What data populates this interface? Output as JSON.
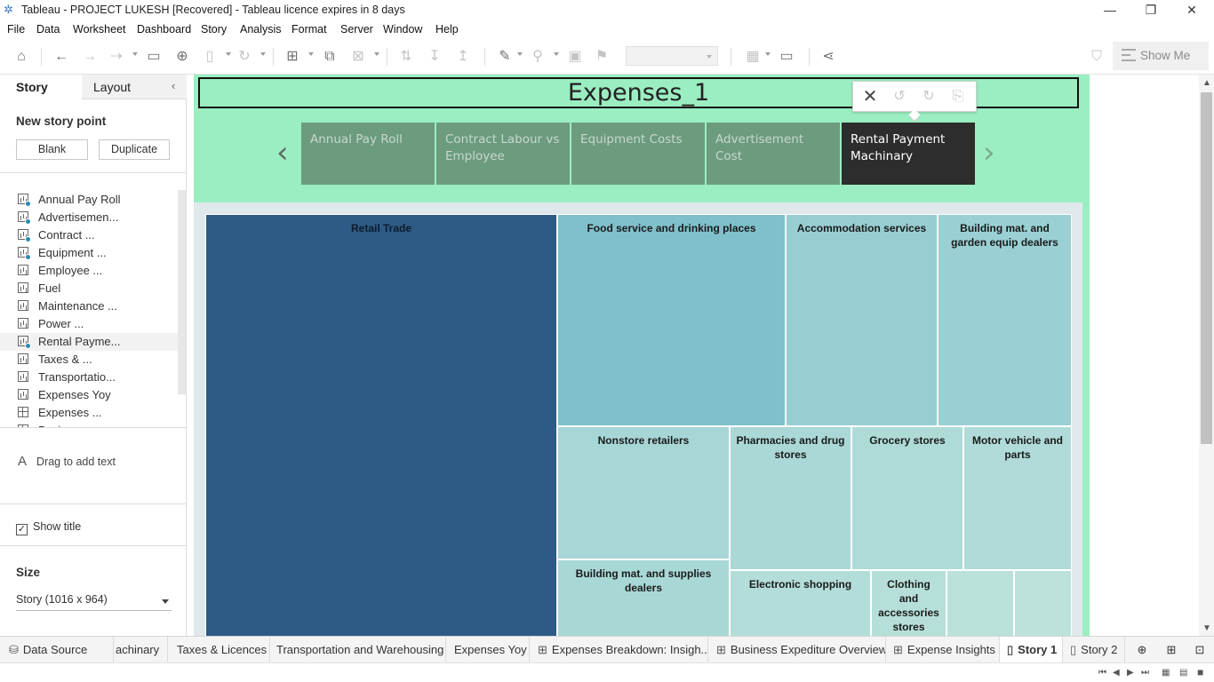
{
  "window": {
    "title": "Tableau - PROJECT LUKESH [Recovered] - Tableau licence expires in 8 days",
    "minimize": "—",
    "restore": "❐",
    "close": "✕"
  },
  "menu": [
    "File",
    "Data",
    "Worksheet",
    "Dashboard",
    "Story",
    "Analysis",
    "Format",
    "Server",
    "Window",
    "Help"
  ],
  "toolbar": {
    "show_me": "Show Me",
    "icons": [
      "home-icon",
      "undo-icon",
      "redo-icon",
      "replay-icon",
      "save-icon",
      "new-data-source-icon",
      "pause-icon",
      "refresh-icon",
      "new-worksheet-icon",
      "duplicate-icon",
      "clear-icon",
      "swap-icon",
      "sort-ascending-icon",
      "sort-descending-icon",
      "highlight-icon",
      "group-icon",
      "labels-icon",
      "pin-icon",
      "fit-icon",
      "presentation-icon",
      "share-icon",
      "paint-roller-icon"
    ]
  },
  "left_panel": {
    "tab_story": "Story",
    "tab_layout": "Layout",
    "new_story_point": "New story point",
    "blank_button": "Blank",
    "duplicate_button": "Duplicate",
    "sheets": [
      {
        "label": "Annual Pay Roll",
        "used": true,
        "icon": "chart"
      },
      {
        "label": "Advertisemen...",
        "used": true,
        "icon": "chart"
      },
      {
        "label": "Contract ...",
        "used": true,
        "icon": "chart"
      },
      {
        "label": "Equipment  ...",
        "used": true,
        "icon": "chart"
      },
      {
        "label": "Employee ...",
        "used": false,
        "icon": "chart"
      },
      {
        "label": "Fuel",
        "used": false,
        "icon": "chart"
      },
      {
        "label": "Maintenance ...",
        "used": false,
        "icon": "chart"
      },
      {
        "label": "Power ...",
        "used": false,
        "icon": "chart"
      },
      {
        "label": "Rental Payme...",
        "used": true,
        "icon": "chart",
        "selected": true
      },
      {
        "label": "Taxes & ...",
        "used": false,
        "icon": "chart"
      },
      {
        "label": "Transportatio...",
        "used": false,
        "icon": "chart"
      },
      {
        "label": "Expenses Yoy",
        "used": false,
        "icon": "chart"
      },
      {
        "label": "Expenses ...",
        "used": false,
        "icon": "grid"
      },
      {
        "label": "Busi...",
        "used": false,
        "icon": "grid"
      }
    ],
    "drag_text": "Drag to add text",
    "show_title": "Show title",
    "show_title_checked": true,
    "size_label": "Size",
    "size_value": "Story (1016 x 964)"
  },
  "story": {
    "title": "Expenses_1",
    "points": [
      {
        "label": "Annual Pay Roll",
        "active": false
      },
      {
        "label": "Contract Labour vs Employee",
        "active": false
      },
      {
        "label": "Equipment Costs",
        "active": false
      },
      {
        "label": "Advertisement Cost",
        "active": false
      },
      {
        "label": "Rental Payment Machinary",
        "active": true
      }
    ],
    "colors": {
      "background": "#9beec1",
      "point": "#6c9b7e",
      "active_point": "#2d2d2d"
    }
  },
  "treemap": {
    "cells": [
      {
        "label": "Retail Trade",
        "color": "#2e5b86"
      },
      {
        "label": "Food service and drinking places",
        "color": "#7fc0cb"
      },
      {
        "label": "Accommodation services",
        "color": "#98ced2"
      },
      {
        "label": "Building mat. and garden equip dealers",
        "color": "#9ad0d4"
      },
      {
        "label": "Nonstore retailers",
        "color": "#a7d6d6"
      },
      {
        "label": "Pharmacies and drug stores",
        "color": "#a9d8d7"
      },
      {
        "label": "Grocery stores",
        "color": "#afdbd7"
      },
      {
        "label": "Motor vehicle and parts",
        "color": "#b0dbd8"
      },
      {
        "label": "Building mat. and supplies dealers",
        "color": "#a8d8d6"
      },
      {
        "label": "Electronic shopping",
        "color": "#b3ddd8"
      },
      {
        "label": "Clothing and accessories stores",
        "color": "#b6dfd9"
      },
      {
        "label": "",
        "color": "#bae1da"
      },
      {
        "label": "",
        "color": "#bce2db"
      }
    ]
  },
  "bottom_tabs": [
    {
      "label": "Data Source",
      "icon": "database-icon",
      "active": false
    },
    {
      "label": "achinary",
      "icon": "",
      "active": false
    },
    {
      "label": "Taxes & Licences",
      "icon": "",
      "active": false
    },
    {
      "label": "Transportation and Warehousing",
      "icon": "",
      "active": false
    },
    {
      "label": "Expenses Yoy",
      "icon": "",
      "active": false
    },
    {
      "label": "Expenses Breakdown: Insigh...",
      "icon": "dashboard-icon",
      "active": false
    },
    {
      "label": "Business Expediture Overview",
      "icon": "dashboard-icon",
      "active": false
    },
    {
      "label": "Expense Insights",
      "icon": "dashboard-icon",
      "active": false
    },
    {
      "label": "Story 1",
      "icon": "story-icon",
      "active": true
    },
    {
      "label": "Story 2",
      "icon": "story-icon",
      "active": false
    }
  ]
}
